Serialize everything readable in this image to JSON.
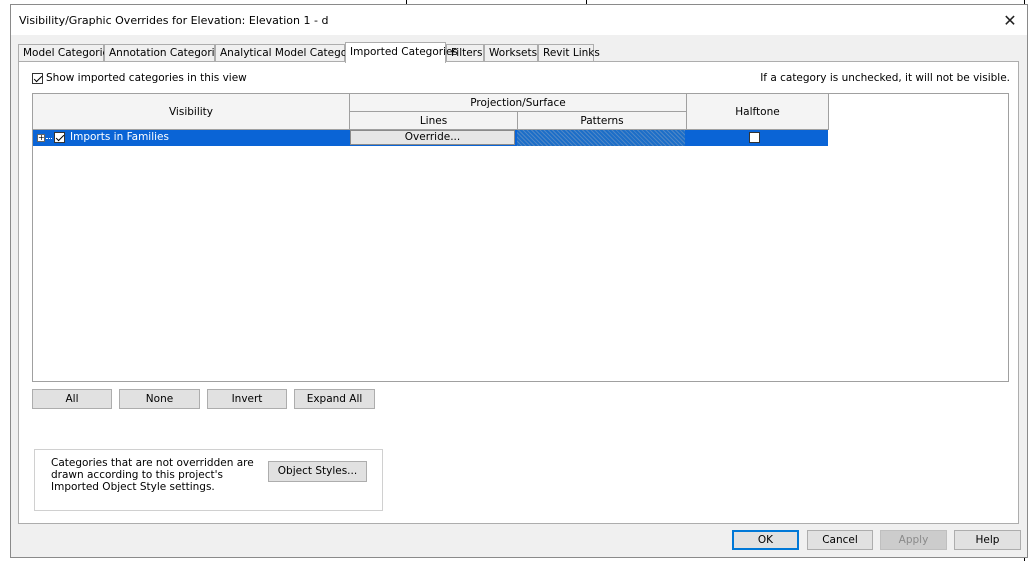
{
  "window": {
    "title": "Visibility/Graphic Overrides for Elevation: Elevation 1 - d",
    "close_glyph": "✕"
  },
  "tabs": [
    {
      "label": "Model Categories",
      "active": false
    },
    {
      "label": "Annotation Categories",
      "active": false
    },
    {
      "label": "Analytical Model Categories",
      "active": false
    },
    {
      "label": "Imported Categories",
      "active": true
    },
    {
      "label": "Filters",
      "active": false
    },
    {
      "label": "Worksets",
      "active": false
    },
    {
      "label": "Revit Links",
      "active": false
    }
  ],
  "options": {
    "show_imported_label": "Show imported categories in this view",
    "show_imported_checked": true,
    "note": "If a category is unchecked, it will not be visible."
  },
  "grid": {
    "headers": {
      "visibility": "Visibility",
      "projection_surface": "Projection/Surface",
      "lines": "Lines",
      "patterns": "Patterns",
      "halftone": "Halftone"
    },
    "rows": [
      {
        "label": "Imports in Families",
        "expander": "+",
        "visible_checked": true,
        "lines_button": "Override...",
        "halftone_checked": false,
        "selected": true
      }
    ]
  },
  "selection_buttons": {
    "all": "All",
    "none": "None",
    "invert": "Invert",
    "expand_all": "Expand All"
  },
  "info": {
    "text": "Categories that are not overridden are drawn according to this project's Imported Object Style settings.",
    "object_styles_button": "Object Styles..."
  },
  "footer_buttons": {
    "ok": "OK",
    "cancel": "Cancel",
    "apply": "Apply",
    "help": "Help"
  },
  "colors": {
    "selection": "#0a64d6",
    "default_button_border": "#0078d7"
  },
  "icons": [
    "close-icon",
    "expand-icon",
    "checkbox-checked-icon",
    "checkbox-unchecked-icon"
  ]
}
